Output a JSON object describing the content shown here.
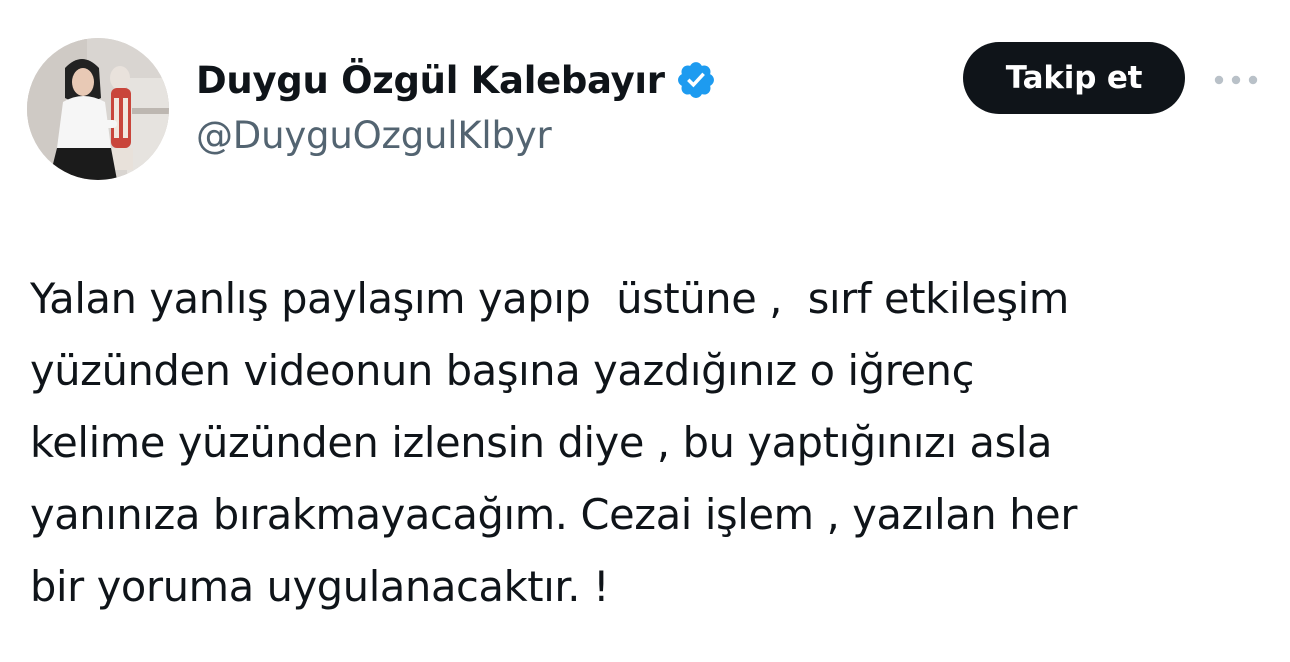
{
  "author": {
    "display_name": "Duygu Özgül Kalebayır",
    "handle": "@DuyguOzgulKlbyr",
    "verified": true,
    "verified_color": "#1d9bf0",
    "avatar_icon": "profile-photo"
  },
  "actions": {
    "follow_label": "Takip et",
    "follow_bg": "#0f1419",
    "more_icon": "more-horizontal-icon"
  },
  "tweet": {
    "lines": [
      "Yalan yanlış paylaşım yapıp  üstüne ,  sırf etkileşim",
      "yüzünden videonun başına yazdığınız o iğrenç",
      "kelime yüzünden izlensin diye , bu yaptığınızı asla",
      "yanınıza bırakmayacağım. Cezai işlem , yazılan her",
      "bir yoruma uygulanacaktır. !"
    ]
  }
}
